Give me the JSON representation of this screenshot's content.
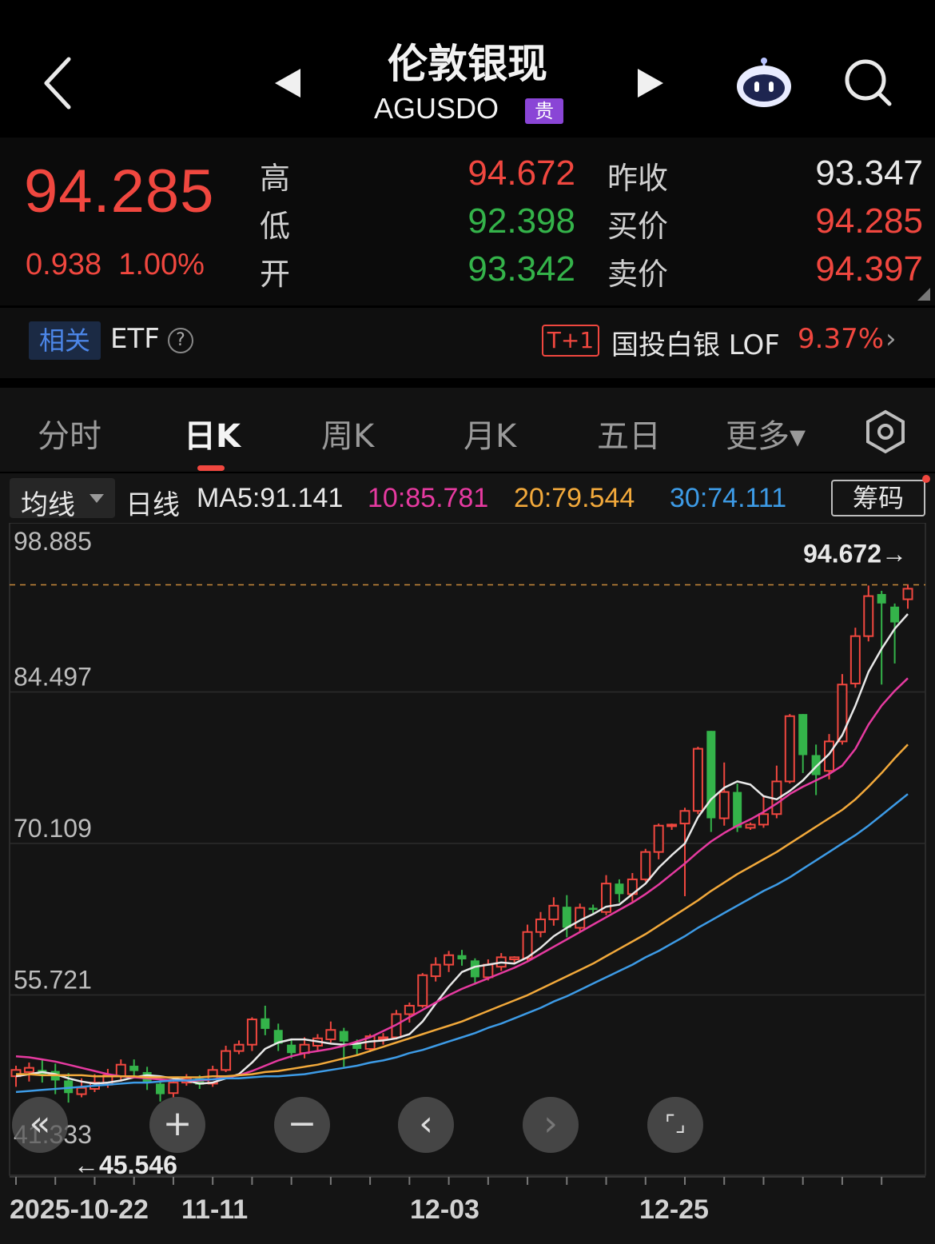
{
  "header": {
    "title": "伦敦银现",
    "subtitle": "AGUSDO",
    "badge": "贵"
  },
  "quote": {
    "price": "94.285",
    "change": "0.938",
    "change_pct": "1.00%",
    "rows": [
      {
        "label1": "高",
        "value1": "94.672",
        "color1": "#f0473f",
        "label2": "昨收",
        "value2": "93.347",
        "color2": "#e8e8e8"
      },
      {
        "label1": "低",
        "value1": "92.398",
        "color1": "#34b34a",
        "label2": "买价",
        "value2": "94.285",
        "color2": "#f0473f"
      },
      {
        "label1": "开",
        "value1": "93.342",
        "color1": "#34b34a",
        "label2": "卖价",
        "value2": "94.397",
        "color2": "#f0473f"
      }
    ]
  },
  "etf": {
    "related": "相关",
    "label": "ETF",
    "help": "?",
    "tag": "T+1",
    "fund": "国投白银 LOF",
    "fund_pct": "9.37%",
    "arrow": "›"
  },
  "tabs": [
    {
      "label": "分时",
      "active": false
    },
    {
      "label": "日K",
      "active": true
    },
    {
      "label": "周K",
      "active": false
    },
    {
      "label": "月K",
      "active": false
    },
    {
      "label": "五日",
      "active": false
    },
    {
      "label": "更多▾",
      "active": false
    }
  ],
  "ma_bar": {
    "selector": "均线",
    "period": "日线",
    "ma5": "MA5:91.141",
    "ma10": "10:85.781",
    "ma20": "20:79.544",
    "ma30": "30:74.111",
    "chip": "筹码"
  },
  "colors": {
    "up": "#f0473f",
    "down": "#34b34a",
    "ma5": "#e8e8e8",
    "ma10": "#e63aa0",
    "ma20": "#f2a93b",
    "ma30": "#3d9be6"
  },
  "zoom_buttons": [
    "«",
    "+",
    "−",
    "‹",
    "›",
    "⌜⌟"
  ],
  "chart_data": {
    "type": "candlestick",
    "y_ticks": [
      "98.885",
      "84.497",
      "70.109",
      "55.721",
      "41.333"
    ],
    "ylim": [
      41.333,
      98.885
    ],
    "x_ticks": [
      "2025-10-22",
      "11-11",
      "12-03",
      "12-25"
    ],
    "max_label": "94.672→",
    "min_label": "←45.546",
    "high_reference": 94.672,
    "candles": [
      [
        48.0,
        48.6,
        47.0,
        49.0
      ],
      [
        48.4,
        48.8,
        47.5,
        49.3
      ],
      [
        48.6,
        48.2,
        47.4,
        49.6
      ],
      [
        48.5,
        47.6,
        46.3,
        49.2
      ],
      [
        47.6,
        46.4,
        45.5,
        48.3
      ],
      [
        46.3,
        46.9,
        46.0,
        47.8
      ],
      [
        46.8,
        47.4,
        46.5,
        48.2
      ],
      [
        47.2,
        48.1,
        46.9,
        48.7
      ],
      [
        48.0,
        49.1,
        47.5,
        49.6
      ],
      [
        49.0,
        48.5,
        47.9,
        49.6
      ],
      [
        48.4,
        47.4,
        46.7,
        48.9
      ],
      [
        47.3,
        46.3,
        45.6,
        47.8
      ],
      [
        46.4,
        47.4,
        46.0,
        47.7
      ],
      [
        47.4,
        47.8,
        47.1,
        48.2
      ],
      [
        47.8,
        47.2,
        46.8,
        48.1
      ],
      [
        47.3,
        48.6,
        47.0,
        49.0
      ],
      [
        48.6,
        50.4,
        48.4,
        50.9
      ],
      [
        50.4,
        51.0,
        50.1,
        51.4
      ],
      [
        51.0,
        53.4,
        50.4,
        53.6
      ],
      [
        53.5,
        52.5,
        51.9,
        54.7
      ],
      [
        52.4,
        51.1,
        50.4,
        53.0
      ],
      [
        51.0,
        50.2,
        49.7,
        51.5
      ],
      [
        50.2,
        51.0,
        49.7,
        51.7
      ],
      [
        50.9,
        51.6,
        50.4,
        52.0
      ],
      [
        51.5,
        52.4,
        51.2,
        53.2
      ],
      [
        52.3,
        51.3,
        48.9,
        52.6
      ],
      [
        51.2,
        50.6,
        50.0,
        51.5
      ],
      [
        50.6,
        51.8,
        50.3,
        52.0
      ],
      [
        51.7,
        51.7,
        51.0,
        52.1
      ],
      [
        51.7,
        53.9,
        51.5,
        54.3
      ],
      [
        53.9,
        54.7,
        53.1,
        55.0
      ],
      [
        54.7,
        57.6,
        54.5,
        57.8
      ],
      [
        57.5,
        58.6,
        57.0,
        59.3
      ],
      [
        58.6,
        59.5,
        57.9,
        59.9
      ],
      [
        59.5,
        59.1,
        58.5,
        60.0
      ],
      [
        59.0,
        57.4,
        56.7,
        59.2
      ],
      [
        57.4,
        58.6,
        57.1,
        59.1
      ],
      [
        58.4,
        59.3,
        58.0,
        59.7
      ],
      [
        59.1,
        59.3,
        58.8,
        59.4
      ],
      [
        59.2,
        61.7,
        59.0,
        62.4
      ],
      [
        61.7,
        62.9,
        61.2,
        63.6
      ],
      [
        62.9,
        64.2,
        62.3,
        65.0
      ],
      [
        64.1,
        62.1,
        61.2,
        65.2
      ],
      [
        62.1,
        64.0,
        61.7,
        64.4
      ],
      [
        64.0,
        63.8,
        63.5,
        64.3
      ],
      [
        63.6,
        66.3,
        63.3,
        67.1
      ],
      [
        66.3,
        65.3,
        64.5,
        66.7
      ],
      [
        65.3,
        66.7,
        64.6,
        67.3
      ],
      [
        66.7,
        69.3,
        66.5,
        69.6
      ],
      [
        69.3,
        71.8,
        68.6,
        72.0
      ],
      [
        71.9,
        71.9,
        71.4,
        72.0
      ],
      [
        72.0,
        73.2,
        65.1,
        73.5
      ],
      [
        73.2,
        79.1,
        72.9,
        79.3
      ],
      [
        80.8,
        72.5,
        71.2,
        80.8
      ],
      [
        72.5,
        75.0,
        71.8,
        77.8
      ],
      [
        75.0,
        71.6,
        71.2,
        75.8
      ],
      [
        71.6,
        71.9,
        71.4,
        72.1
      ],
      [
        71.9,
        72.9,
        71.6,
        74.7
      ],
      [
        72.9,
        76.0,
        72.5,
        77.5
      ],
      [
        76.0,
        82.2,
        75.8,
        82.4
      ],
      [
        82.4,
        78.5,
        76.8,
        82.4
      ],
      [
        78.5,
        76.6,
        74.7,
        79.5
      ],
      [
        77.0,
        79.8,
        76.2,
        80.5
      ],
      [
        79.8,
        85.2,
        79.5,
        86.2
      ],
      [
        85.3,
        89.8,
        84.9,
        90.6
      ],
      [
        89.8,
        93.6,
        89.3,
        94.6
      ],
      [
        93.8,
        92.9,
        85.2,
        94.1
      ],
      [
        92.6,
        91.1,
        87.2,
        92.9
      ],
      [
        93.3,
        94.3,
        92.4,
        94.7
      ]
    ],
    "ma_series": [
      {
        "name": "MA5",
        "values": [
          48.0,
          48.2,
          48.4,
          48.2,
          47.8,
          47.5,
          47.3,
          47.4,
          47.6,
          47.9,
          48.1,
          48.0,
          47.8,
          47.6,
          47.3,
          47.4,
          47.8,
          48.2,
          49.3,
          50.6,
          51.2,
          51.5,
          51.5,
          51.3,
          51.1,
          51.0,
          51.1,
          51.3,
          51.4,
          51.6,
          52.0,
          53.2,
          54.9,
          56.5,
          57.9,
          58.4,
          58.6,
          58.8,
          58.7,
          59.3,
          60.2,
          61.3,
          62.1,
          62.8,
          63.4,
          64.1,
          64.3,
          65.3,
          66.3,
          67.8,
          69.0,
          70.1,
          72.6,
          74.3,
          75.4,
          76.0,
          75.7,
          74.6,
          74.3,
          75.1,
          76.1,
          77.4,
          78.6,
          80.4,
          83.2,
          86.4,
          88.6,
          90.5,
          91.9
        ]
      },
      {
        "name": "MA10",
        "values": [
          49.9,
          49.8,
          49.6,
          49.4,
          49.1,
          48.8,
          48.5,
          48.2,
          48.0,
          47.9,
          47.8,
          47.7,
          47.6,
          47.6,
          47.6,
          47.7,
          47.9,
          48.1,
          48.5,
          49.0,
          49.5,
          49.9,
          50.2,
          50.4,
          50.6,
          50.9,
          51.3,
          51.7,
          52.3,
          52.9,
          53.6,
          54.3,
          55.0,
          55.7,
          56.3,
          56.8,
          57.3,
          57.8,
          58.3,
          58.9,
          59.6,
          60.3,
          61.0,
          61.7,
          62.4,
          63.1,
          63.8,
          64.5,
          65.3,
          66.2,
          67.2,
          68.2,
          69.3,
          70.3,
          71.1,
          71.8,
          72.4,
          73.1,
          73.9,
          74.8,
          75.5,
          76.1,
          76.7,
          77.5,
          79.1,
          81.4,
          83.2,
          84.6,
          85.8
        ]
      },
      {
        "name": "MA20",
        "values": [
          48.2,
          48.2,
          48.1,
          48.1,
          48.1,
          48.1,
          48.0,
          48.0,
          48.0,
          48.0,
          47.9,
          47.9,
          47.9,
          47.9,
          47.9,
          48.0,
          48.0,
          48.1,
          48.2,
          48.4,
          48.5,
          48.7,
          48.9,
          49.1,
          49.4,
          49.7,
          50.0,
          50.4,
          50.8,
          51.2,
          51.6,
          52.0,
          52.4,
          52.8,
          53.2,
          53.7,
          54.2,
          54.7,
          55.2,
          55.7,
          56.3,
          56.9,
          57.5,
          58.1,
          58.7,
          59.4,
          60.1,
          60.8,
          61.5,
          62.3,
          63.1,
          63.9,
          64.7,
          65.6,
          66.4,
          67.2,
          67.9,
          68.6,
          69.3,
          70.1,
          70.9,
          71.7,
          72.5,
          73.3,
          74.3,
          75.5,
          76.8,
          78.2,
          79.5
        ]
      },
      {
        "name": "MA30",
        "values": [
          46.5,
          46.6,
          46.7,
          46.8,
          46.9,
          47.0,
          47.1,
          47.2,
          47.3,
          47.4,
          47.4,
          47.5,
          47.6,
          47.6,
          47.7,
          47.7,
          47.8,
          47.8,
          47.9,
          48.0,
          48.0,
          48.1,
          48.2,
          48.4,
          48.6,
          48.8,
          49.0,
          49.3,
          49.5,
          49.8,
          50.2,
          50.5,
          50.9,
          51.3,
          51.7,
          52.1,
          52.6,
          53.0,
          53.5,
          54.0,
          54.5,
          55.1,
          55.6,
          56.2,
          56.8,
          57.4,
          58.0,
          58.6,
          59.3,
          59.9,
          60.6,
          61.3,
          62.1,
          62.8,
          63.5,
          64.2,
          64.9,
          65.6,
          66.2,
          66.9,
          67.7,
          68.5,
          69.3,
          70.1,
          70.9,
          71.8,
          72.8,
          73.8,
          74.8
        ]
      }
    ]
  }
}
